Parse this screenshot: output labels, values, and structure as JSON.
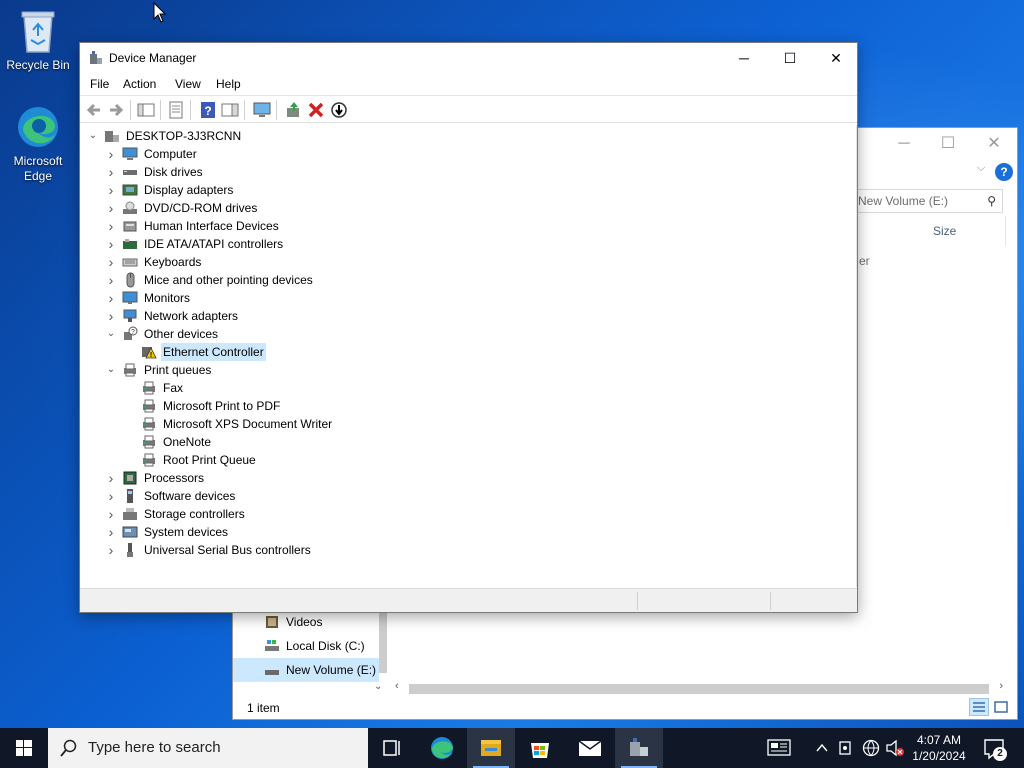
{
  "desktop": {
    "icons": [
      {
        "label": "Recycle Bin"
      },
      {
        "label": "Microsoft Edge"
      }
    ]
  },
  "explorer": {
    "search_placeholder": "New Volume (E:)",
    "column_header": "Size",
    "partial_text": "er",
    "nav_items": [
      {
        "label": "Videos"
      },
      {
        "label": "Local Disk (C:)"
      },
      {
        "label": "New Volume (E:)"
      }
    ],
    "status": "1 item",
    "help_label": "?"
  },
  "device_manager": {
    "title": "Device Manager",
    "menu": [
      "File",
      "Action",
      "View",
      "Help"
    ],
    "root": "DESKTOP-3J3RCNN",
    "categories": [
      {
        "label": "Computer",
        "expanded": false
      },
      {
        "label": "Disk drives",
        "expanded": false
      },
      {
        "label": "Display adapters",
        "expanded": false
      },
      {
        "label": "DVD/CD-ROM drives",
        "expanded": false
      },
      {
        "label": "Human Interface Devices",
        "expanded": false
      },
      {
        "label": "IDE ATA/ATAPI controllers",
        "expanded": false
      },
      {
        "label": "Keyboards",
        "expanded": false
      },
      {
        "label": "Mice and other pointing devices",
        "expanded": false
      },
      {
        "label": "Monitors",
        "expanded": false
      },
      {
        "label": "Network adapters",
        "expanded": false
      },
      {
        "label": "Other devices",
        "expanded": true,
        "children": [
          "Ethernet Controller"
        ]
      },
      {
        "label": "Print queues",
        "expanded": true,
        "children": [
          "Fax",
          "Microsoft Print to PDF",
          "Microsoft XPS Document Writer",
          "OneNote",
          "Root Print Queue"
        ]
      },
      {
        "label": "Processors",
        "expanded": false
      },
      {
        "label": "Software devices",
        "expanded": false
      },
      {
        "label": "Storage controllers",
        "expanded": false
      },
      {
        "label": "System devices",
        "expanded": false
      },
      {
        "label": "Universal Serial Bus controllers",
        "expanded": false
      }
    ],
    "selected_item": "Ethernet Controller"
  },
  "taskbar": {
    "search_placeholder": "Type here to search",
    "time": "4:07 AM",
    "date": "1/20/2024",
    "notification_count": "2"
  },
  "colors": {
    "accent": "#0078d7",
    "selection": "#cce8ff",
    "taskbar": "#101828"
  }
}
